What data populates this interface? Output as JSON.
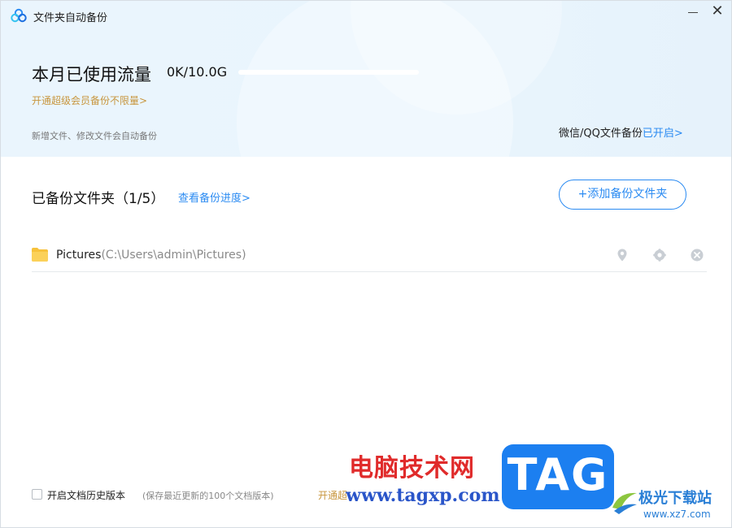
{
  "window": {
    "title": "文件夹自动备份",
    "close_glyph": "✕"
  },
  "usage": {
    "label": "本月已使用流量",
    "value": "0K/10.0G",
    "fraction": 0
  },
  "vip_link": "开通超级会员备份不限量>",
  "auto_backup_desc": "新增文件、修改文件会自动备份",
  "wechat": {
    "label": "微信/QQ文件备份",
    "status_link": "已开启>"
  },
  "backup_section": {
    "title": "已备份文件夹（1/5）",
    "progress_link": "查看备份进度>",
    "add_button": "+添加备份文件夹"
  },
  "folders": [
    {
      "name": "Pictures",
      "path": "(C:\\Users\\admin\\Pictures)"
    }
  ],
  "footer": {
    "history_label": "开启文档历史版本",
    "history_note": "(保存最近更新的100个文档版本)",
    "vip_link": "开通超"
  },
  "watermarks": {
    "cn_text": "电脑技术网",
    "url": "www.tagxp.com",
    "tag": "TAG",
    "xz_name": "极光下载站",
    "xz_url": "www.xz7.com"
  },
  "colors": {
    "accent": "#2b8bf2",
    "vip": "#c8963e",
    "folder": "#f7c23c"
  }
}
